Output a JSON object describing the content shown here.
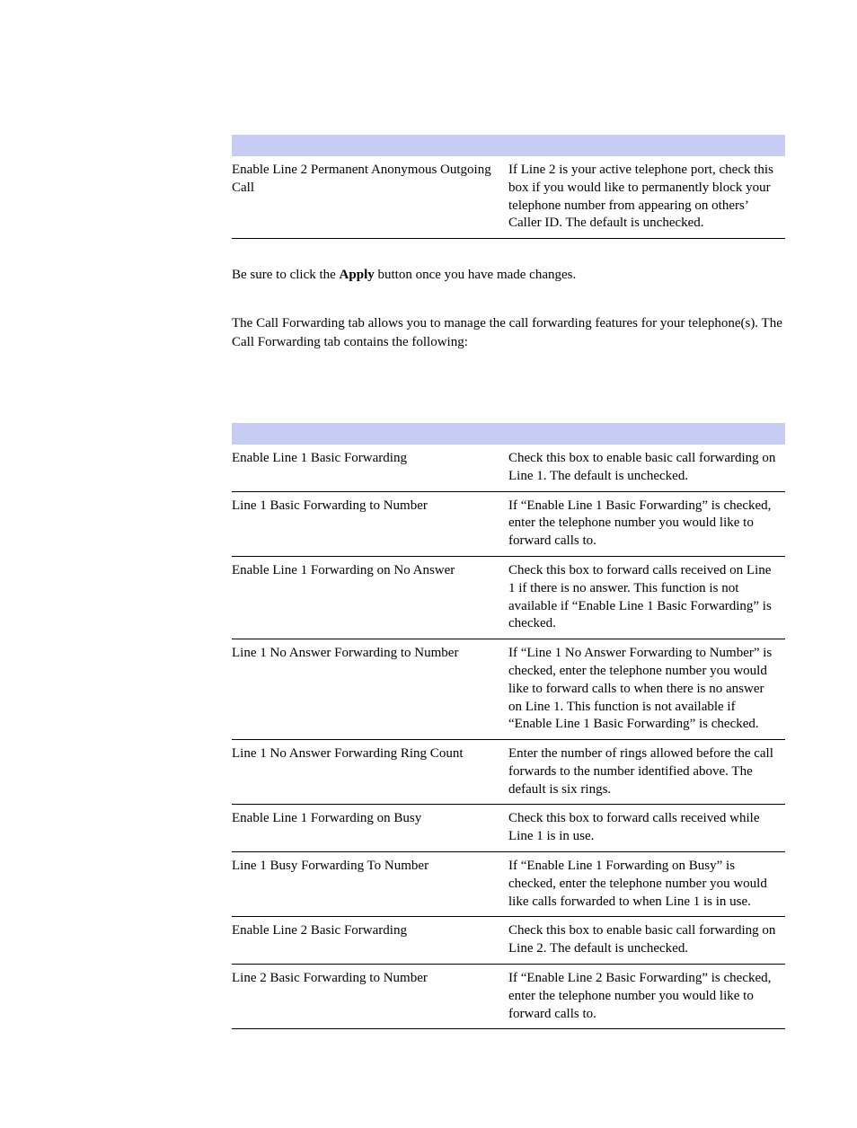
{
  "table1": {
    "rows": [
      {
        "field": "Enable Line 2 Permanent Anonymous Outgoing Call",
        "desc": "If Line 2 is your active telephone port, check this box if you would like to permanently block your telephone number from appearing on others’ Caller ID. The default is unchecked."
      }
    ]
  },
  "apply_note_pre": "Be sure to click the ",
  "apply_note_strong": "Apply",
  "apply_note_post": " button once you have made changes.",
  "forwarding_intro": "The Call Forwarding tab allows you to manage the call forwarding features for your telephone(s). The Call Forwarding tab contains the following:",
  "table2": {
    "rows": [
      {
        "field": "Enable Line 1 Basic Forwarding",
        "desc": "Check this box to enable basic call forwarding on Line 1. The default is unchecked."
      },
      {
        "field": "Line 1 Basic Forwarding to Number",
        "desc": "If “Enable Line 1 Basic Forwarding” is checked, enter the telephone number you would like to forward calls to."
      },
      {
        "field": "Enable Line 1 Forwarding on No Answer",
        "desc": "Check this box to forward calls received on Line 1 if there is no answer. This function is not available if “Enable Line 1 Basic Forwarding” is checked."
      },
      {
        "field": "Line 1 No Answer Forwarding to Number",
        "desc": "If “Line 1 No Answer Forwarding to Number” is checked, enter the telephone number you would like to forward calls to when there is no answer on Line 1. This function is not available if “Enable Line 1 Basic Forwarding” is checked."
      },
      {
        "field": "Line 1 No Answer Forwarding Ring Count",
        "desc": "Enter the number of rings allowed before the call forwards to the number identified above. The default is six rings."
      },
      {
        "field": "Enable Line 1 Forwarding on Busy",
        "desc": "Check this box to forward calls received while Line 1 is in use."
      },
      {
        "field": "Line 1 Busy Forwarding To Number",
        "desc": "If “Enable Line 1 Forwarding on Busy” is checked, enter the telephone number you would like calls forwarded to when Line 1 is in use."
      },
      {
        "field": "Enable Line 2 Basic Forwarding",
        "desc": "Check this box to enable basic call forwarding on Line 2. The default is unchecked."
      },
      {
        "field": "Line 2 Basic Forwarding to Number",
        "desc": "If “Enable Line 2 Basic Forwarding” is checked, enter the telephone number you would like to forward calls to."
      }
    ]
  }
}
